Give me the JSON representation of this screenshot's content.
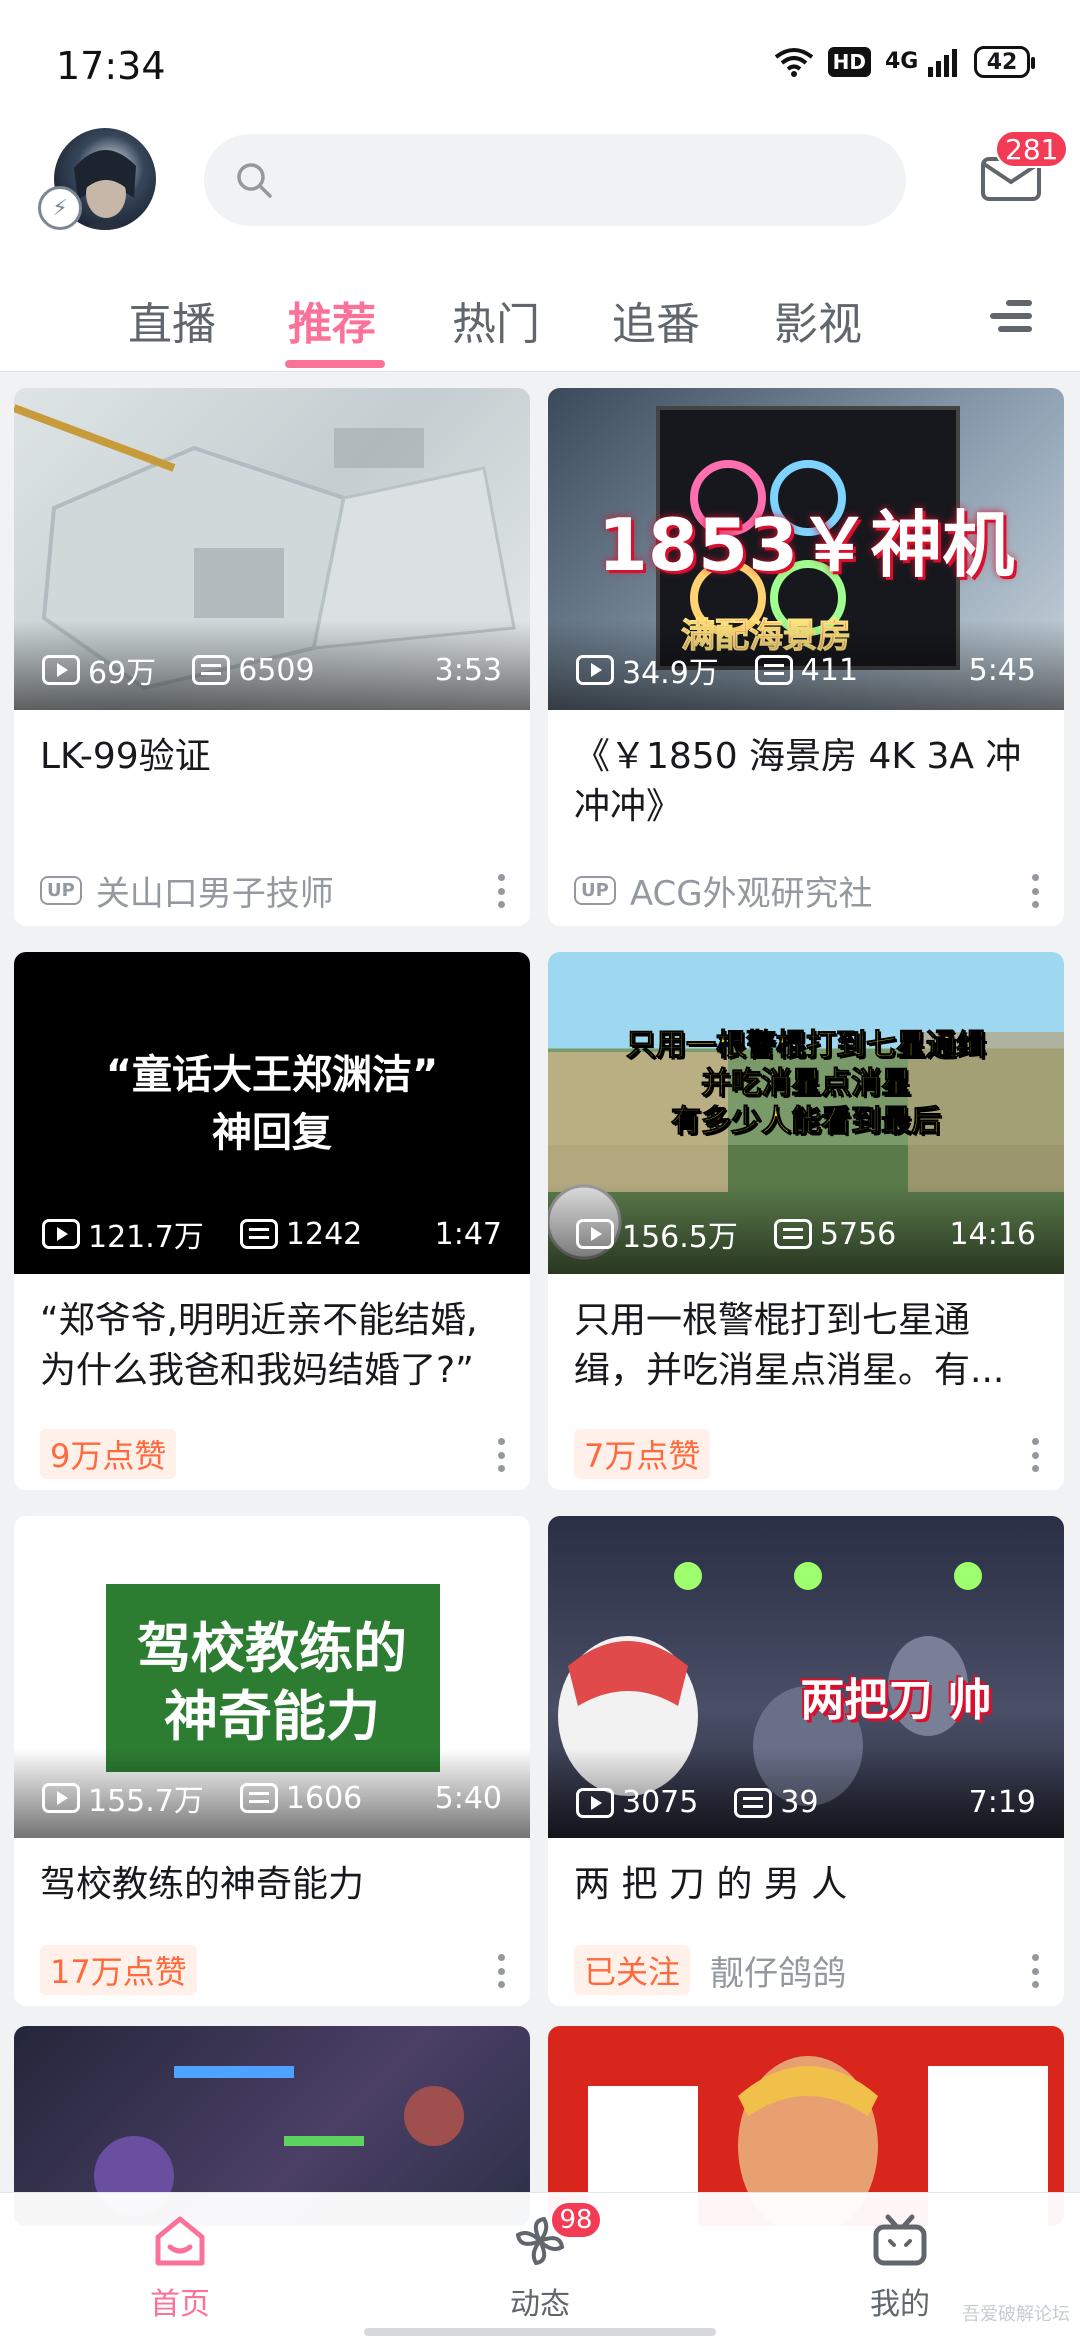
{
  "status_bar": {
    "time": "17:34",
    "hd": "HD",
    "network": "4G",
    "battery": "42"
  },
  "header": {
    "search_placeholder": "",
    "mail_badge": "281"
  },
  "tabs": [
    {
      "label": "直播"
    },
    {
      "label": "推荐",
      "active": true
    },
    {
      "label": "热门"
    },
    {
      "label": "追番"
    },
    {
      "label": "影视"
    }
  ],
  "feed": [
    {
      "views": "69万",
      "danmaku": "6509",
      "duration": "3:53",
      "title": "LK-99验证",
      "up_badge": "UP",
      "up_name": "关山口男子技师"
    },
    {
      "views": "34.9万",
      "danmaku": "411",
      "duration": "5:45",
      "title": "《￥1850 海景房 4K 3A 冲冲冲》",
      "up_badge": "UP",
      "up_name": "ACG外观研究社",
      "thumb_text_big": "1853￥神机",
      "thumb_text_small": "满配海景房"
    },
    {
      "views": "121.7万",
      "danmaku": "1242",
      "duration": "1:47",
      "title": "“郑爷爷,明明近亲不能结婚,为什么我爸和我妈结婚了?”",
      "like_tag": "9万点赞",
      "thumb_line1": "“童话大王郑渊洁”",
      "thumb_line2": "神回复"
    },
    {
      "views": "156.5万",
      "danmaku": "5756",
      "duration": "14:16",
      "title": "只用一根警棍打到七星通缉，并吃消星点消星。有...",
      "like_tag": "7万点赞",
      "thumb_line1": "只用一根警棍打到七星通缉",
      "thumb_line2": "并吃消星点消星",
      "thumb_line3": "有多少人能看到最后"
    },
    {
      "views": "155.7万",
      "danmaku": "1606",
      "duration": "5:40",
      "title": "驾校教练的神奇能力",
      "like_tag": "17万点赞",
      "thumb_line1": "驾校教练的",
      "thumb_line2": "神奇能力"
    },
    {
      "views": "3075",
      "danmaku": "39",
      "duration": "7:19",
      "title": "两 把 刀 的 男 人",
      "follow_tag": "已关注",
      "up_name": "靓仔鸽鸽",
      "thumb_line1": "两把刀 帅"
    }
  ],
  "bottom_nav": [
    {
      "label": "首页",
      "active": true
    },
    {
      "label": "动态",
      "badge": "98"
    },
    {
      "label": "我的"
    }
  ],
  "watermark": "吾爱破解论坛"
}
